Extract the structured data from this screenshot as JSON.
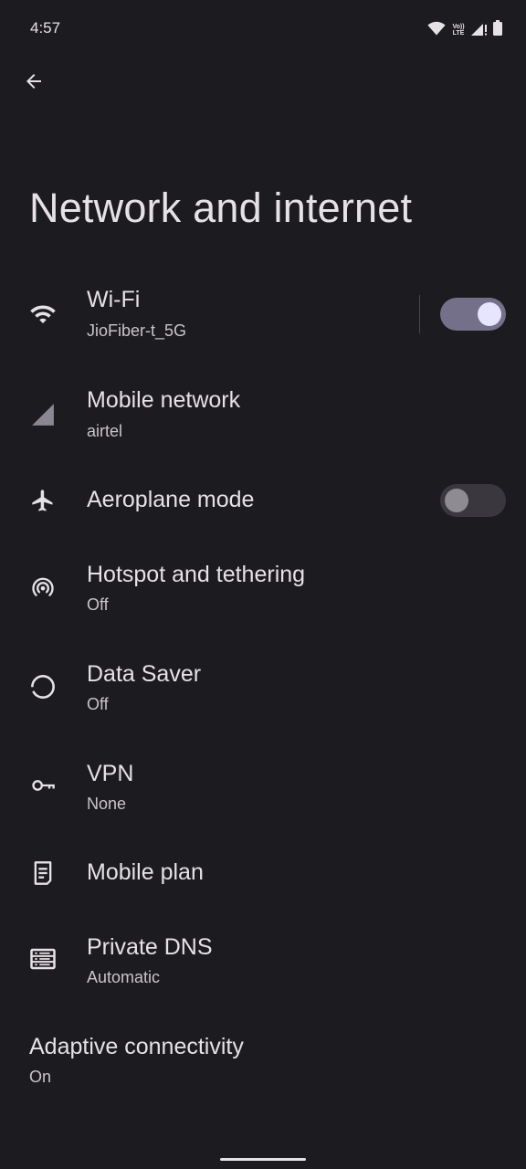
{
  "status_bar": {
    "time": "4:57",
    "volte_top": "Vo))",
    "volte_bottom": "LTE"
  },
  "header": {
    "back_icon": "arrow-left-icon",
    "title": "Network and internet"
  },
  "items": [
    {
      "id": "wifi",
      "icon": "wifi-icon",
      "title": "Wi-Fi",
      "subtitle": "JioFiber-t_5G",
      "toggle": true
    },
    {
      "id": "mobile-network",
      "icon": "signal-icon",
      "title": "Mobile network",
      "subtitle": "airtel"
    },
    {
      "id": "aeroplane-mode",
      "icon": "airplane-icon",
      "title": "Aeroplane mode",
      "toggle": false
    },
    {
      "id": "hotspot",
      "icon": "hotspot-icon",
      "title": "Hotspot and tethering",
      "subtitle": "Off"
    },
    {
      "id": "data-saver",
      "icon": "data-saver-icon",
      "title": "Data Saver",
      "subtitle": "Off"
    },
    {
      "id": "vpn",
      "icon": "key-icon",
      "title": "VPN",
      "subtitle": "None"
    },
    {
      "id": "mobile-plan",
      "icon": "receipt-icon",
      "title": "Mobile plan"
    },
    {
      "id": "private-dns",
      "icon": "dns-icon",
      "title": "Private DNS",
      "subtitle": "Automatic"
    },
    {
      "id": "adaptive-connectivity",
      "title": "Adaptive connectivity",
      "subtitle": "On"
    }
  ],
  "colors": {
    "background": "#1c1b1f",
    "text_primary": "#e6e1e5",
    "text_secondary": "#c9c5ca",
    "toggle_on_track": "#74708a",
    "toggle_on_thumb": "#e7e4ff",
    "toggle_off_track": "#3a383e",
    "toggle_off_thumb": "#8e8b92"
  }
}
